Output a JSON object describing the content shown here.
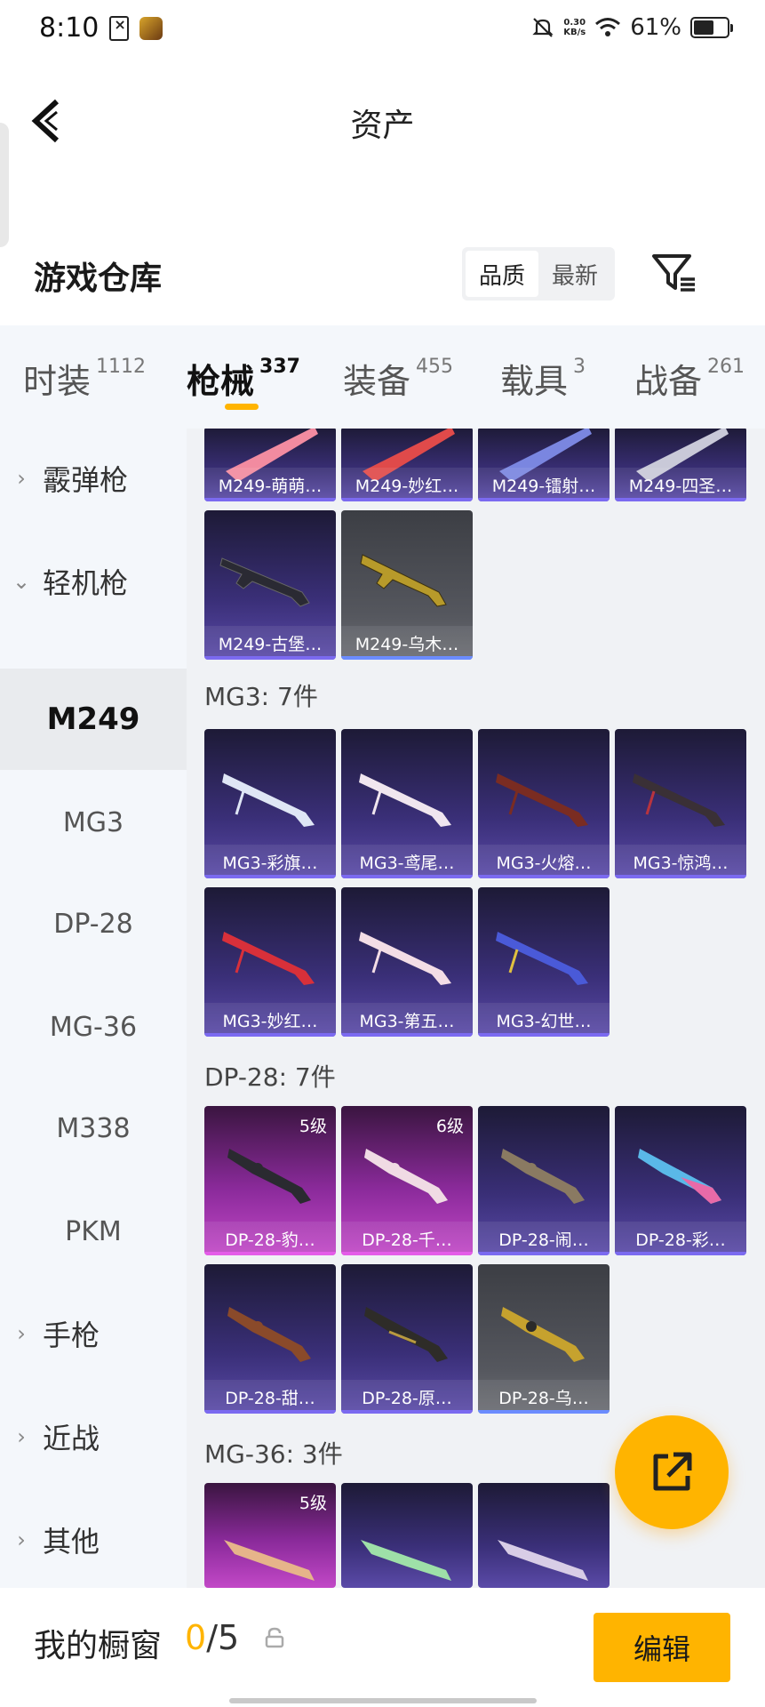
{
  "status_bar": {
    "time": "8:10",
    "net_speed_top": "0.30",
    "net_speed_bottom": "KB/s",
    "battery_pct": "61%",
    "battery_level": 0.61
  },
  "header": {
    "title": "资产"
  },
  "warehouse": {
    "title": "游戏仓库",
    "sort_options": [
      "品质",
      "最新"
    ],
    "sort_active": "品质"
  },
  "tabs": [
    {
      "label": "时装",
      "count": "1112"
    },
    {
      "label": "枪械",
      "count": "337",
      "active": true
    },
    {
      "label": "装备",
      "count": "455"
    },
    {
      "label": "载具",
      "count": "3"
    },
    {
      "label": "战备",
      "count": "261"
    }
  ],
  "sidebar": {
    "groups": [
      {
        "label": "霰弹枪",
        "expanded": false
      },
      {
        "label": "轻机枪",
        "expanded": true
      },
      {
        "label": "手枪",
        "expanded": false
      },
      {
        "label": "近战",
        "expanded": false
      },
      {
        "label": "其他",
        "expanded": false
      }
    ],
    "subitems": [
      "M249",
      "MG3",
      "DP-28",
      "MG-36",
      "M338",
      "PKM"
    ],
    "active_sub": "M249"
  },
  "sections": {
    "m249": {
      "items": [
        "M249-萌萌…",
        "M249-妙红…",
        "M249-镭射…",
        "M249-四圣…",
        "M249-古堡…",
        "M249-乌木…"
      ]
    },
    "mg3": {
      "title": "MG3: 7件",
      "items": [
        "MG3-彩旗…",
        "MG3-鸢尾…",
        "MG3-火熔…",
        "MG3-惊鸿…",
        "MG3-妙红…",
        "MG3-第五…",
        "MG3-幻世…"
      ]
    },
    "dp28": {
      "title": "DP-28: 7件",
      "items": [
        "DP-28-豹…",
        "DP-28-千…",
        "DP-28-闹…",
        "DP-28-彩…",
        "DP-28-甜…",
        "DP-28-原…",
        "DP-28-乌…"
      ],
      "levels": [
        "5级",
        "6级"
      ]
    },
    "mg36": {
      "title": "MG-36: 3件",
      "levels": [
        "5级"
      ]
    }
  },
  "bottom": {
    "label": "我的橱窗",
    "current": "0",
    "total": "/5",
    "edit_label": "编辑"
  }
}
